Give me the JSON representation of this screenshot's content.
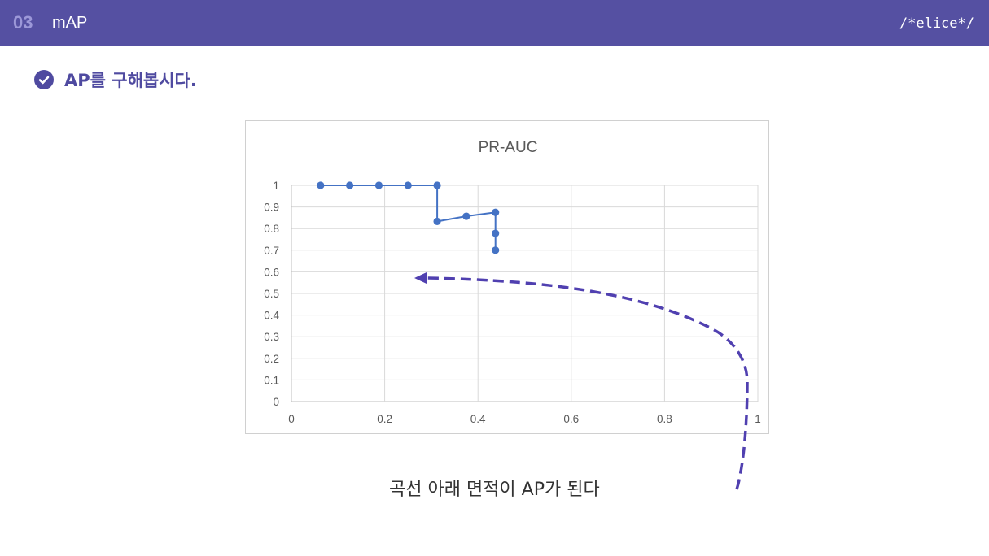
{
  "header": {
    "section_number": "03",
    "section_title": "mAP",
    "logo": "/*elice*/"
  },
  "heading": {
    "icon": "check-circle-icon",
    "text": "AP를 구해봅시다."
  },
  "caption": "곡선 아래 면적이 AP가 된다",
  "colors": {
    "header_bg": "#5550a2",
    "accent": "#4f4aa0",
    "series": "#4472c4",
    "arrow": "#5040b0"
  },
  "chart_data": {
    "type": "line",
    "title": "PR-AUC",
    "xlabel": "",
    "ylabel": "",
    "xlim": [
      0,
      1
    ],
    "ylim": [
      0,
      1
    ],
    "x_ticks": [
      "0",
      "0.2",
      "0.4",
      "0.6",
      "0.8",
      "1"
    ],
    "y_ticks": [
      "0",
      "0.1",
      "0.2",
      "0.3",
      "0.4",
      "0.5",
      "0.6",
      "0.7",
      "0.8",
      "0.9",
      "1"
    ],
    "grid": true,
    "legend": "none",
    "series": [
      {
        "x": [
          0.0625,
          0.125,
          0.1875,
          0.25,
          0.3125,
          0.3125,
          0.375,
          0.4375,
          0.4375,
          0.4375
        ],
        "y": [
          1,
          1,
          1,
          1,
          1,
          0.833,
          0.857,
          0.875,
          0.778,
          0.7
        ]
      }
    ]
  }
}
